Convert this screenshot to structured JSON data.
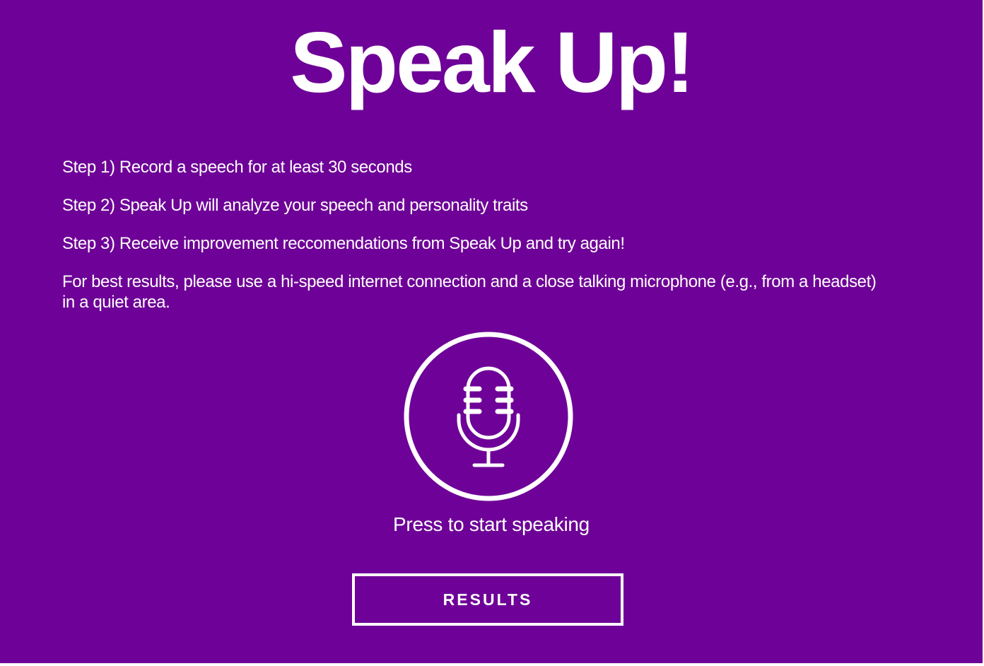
{
  "app": {
    "title": "Speak Up!"
  },
  "instructions": {
    "step1": "Step 1) Record a speech for at least 30 seconds",
    "step2": "Step 2) Speak Up will analyze your speech and personality traits",
    "step3": "Step 3) Receive improvement reccomendations from Speak Up and try again!",
    "tip": "For best results, please use a hi-speed internet connection and a close talking microphone (e.g., from a headset) in a quiet area."
  },
  "record": {
    "icon": "microphone-icon",
    "prompt": "Press to start speaking"
  },
  "results": {
    "label": "RESULTS"
  },
  "colors": {
    "background": "#6e0197",
    "foreground": "#ffffff"
  }
}
